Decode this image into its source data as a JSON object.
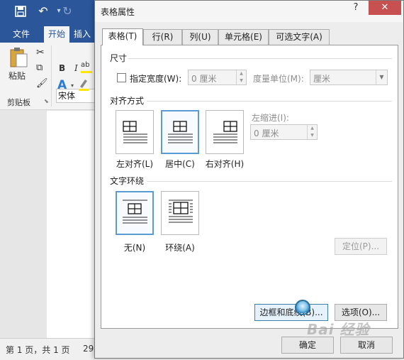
{
  "word": {
    "quick_access": {
      "save_icon": "save-icon",
      "undo_icon": "undo-icon",
      "redo_icon": "redo-icon"
    },
    "tabs": [
      "文件",
      "开始",
      "插入"
    ],
    "ribbon": {
      "paste_label": "粘贴",
      "font_name": "宋体",
      "clipboard_group": "剪贴板",
      "bold": "B",
      "italic": "I",
      "text_effect": "A",
      "highlight": "ab"
    },
    "status": {
      "page_info": "第 1 页，共 1 页",
      "extra": "29"
    }
  },
  "dialog": {
    "title": "表格属性",
    "help": "?",
    "close": "✕",
    "tabs": [
      "表格(T)",
      "行(R)",
      "列(U)",
      "单元格(E)",
      "可选文字(A)"
    ],
    "active_tab": 0,
    "size_section": {
      "title": "尺寸",
      "preferred_width_label": "指定宽度(W):",
      "preferred_width_value": "0 厘米",
      "measure_in_label": "度量单位(M):",
      "measure_in_value": "厘米"
    },
    "alignment_section": {
      "title": "对齐方式",
      "options": [
        "左对齐(L)",
        "居中(C)",
        "右对齐(H)"
      ],
      "selected": 1,
      "indent_label": "左缩进(I):",
      "indent_value": "0 厘米"
    },
    "wrap_section": {
      "title": "文字环绕",
      "options": [
        "无(N)",
        "环绕(A)"
      ],
      "selected": 0,
      "positioning_button": "定位(P)..."
    },
    "borders_button": "边框和底纹(B)...",
    "options_button": "选项(O)...",
    "ok_button": "确定",
    "cancel_button": "取消"
  },
  "watermark": "Bai 经验",
  "colors": {
    "word_blue": "#2b579a",
    "selected_border": "#5b9bd5",
    "close_red": "#c75050"
  }
}
